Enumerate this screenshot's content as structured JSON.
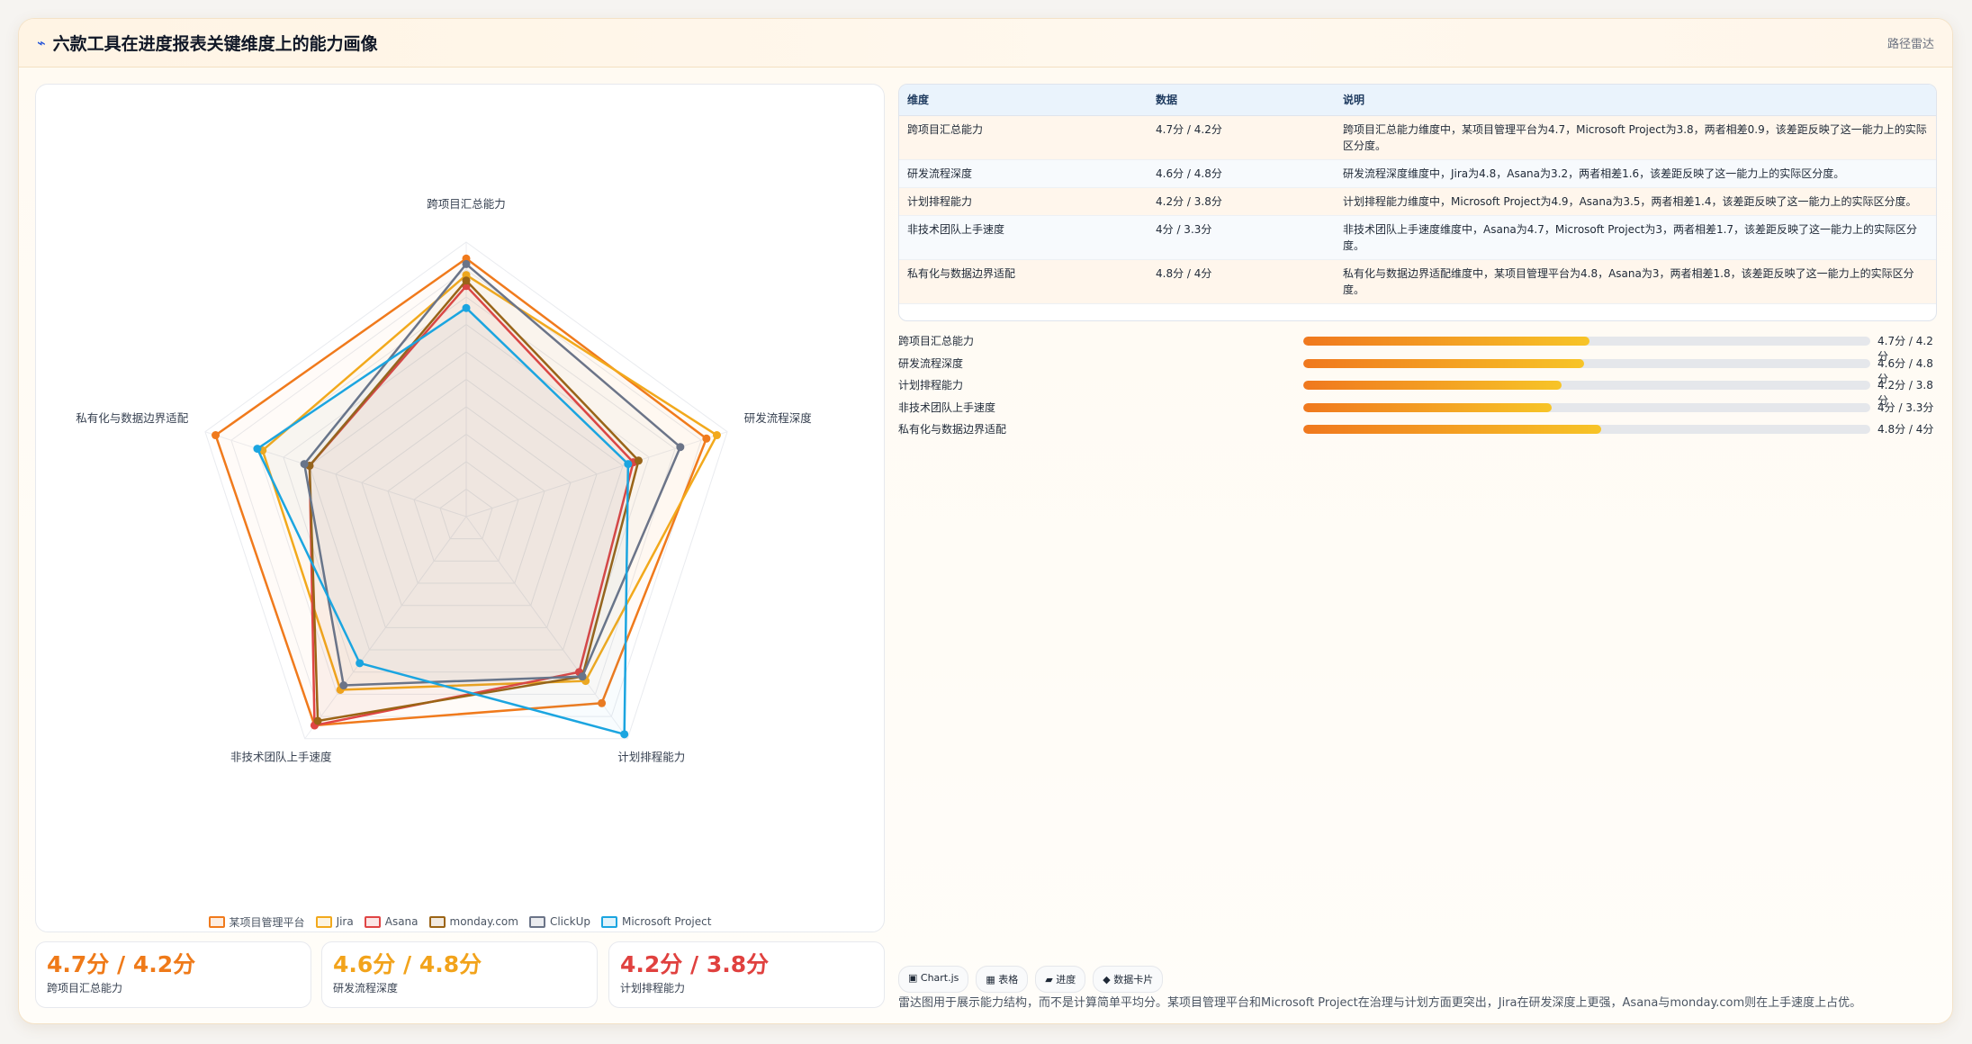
{
  "header": {
    "icon": "route-icon",
    "title": "六款工具在进度报表关键维度上的能力画像",
    "tag": "路径雷达"
  },
  "chart_data": {
    "type": "radar",
    "axes": [
      "跨项目汇总能力",
      "研发流程深度",
      "计划排程能力",
      "非技术团队上手速度",
      "私有化与数据边界适配"
    ],
    "range": [
      0,
      5
    ],
    "grid_levels": 10,
    "series": [
      {
        "name": "某项目管理平台",
        "color": "#f07a1c",
        "values": [
          4.7,
          4.6,
          4.2,
          4.7,
          4.8
        ]
      },
      {
        "name": "Jira",
        "color": "#f2a91c",
        "values": [
          4.4,
          4.8,
          3.7,
          3.9,
          3.9
        ]
      },
      {
        "name": "Asana",
        "color": "#e04545",
        "values": [
          4.2,
          3.2,
          3.5,
          4.7,
          3.0
        ]
      },
      {
        "name": "monday.com",
        "color": "#9b6415",
        "values": [
          4.3,
          3.3,
          3.6,
          4.6,
          3.0
        ]
      },
      {
        "name": "ClickUp",
        "color": "#6b7488",
        "values": [
          4.6,
          4.1,
          3.6,
          3.8,
          3.1
        ]
      },
      {
        "name": "Microsoft Project",
        "color": "#1ba5e0",
        "values": [
          3.8,
          3.1,
          4.9,
          3.3,
          4.0
        ]
      }
    ]
  },
  "kpis": [
    {
      "value": "4.7分 / 4.2分",
      "label": "跨项目汇总能力",
      "color": "#ef7a19"
    },
    {
      "value": "4.6分 / 4.8分",
      "label": "研发流程深度",
      "color": "#f2a31b"
    },
    {
      "value": "4.2分 / 3.8分",
      "label": "计划排程能力",
      "color": "#e0413f"
    }
  ],
  "table": {
    "headers": [
      "维度",
      "数据",
      "说明"
    ],
    "rows": [
      [
        "跨项目汇总能力",
        "4.7分 / 4.2分",
        "跨项目汇总能力维度中，某项目管理平台为4.7，Microsoft Project为3.8，两者相差0.9，该差距反映了这一能力上的实际区分度。"
      ],
      [
        "研发流程深度",
        "4.6分 / 4.8分",
        "研发流程深度维度中，Jira为4.8，Asana为3.2，两者相差1.6，该差距反映了这一能力上的实际区分度。"
      ],
      [
        "计划排程能力",
        "4.2分 / 3.8分",
        "计划排程能力维度中，Microsoft Project为4.9，Asana为3.5，两者相差1.4，该差距反映了这一能力上的实际区分度。"
      ],
      [
        "非技术团队上手速度",
        "4分 / 3.3分",
        "非技术团队上手速度维度中，Asana为4.7，Microsoft Project为3，两者相差1.7，该差距反映了这一能力上的实际区分度。"
      ],
      [
        "私有化与数据边界适配",
        "4.8分 / 4分",
        "私有化与数据边界适配维度中，某项目管理平台为4.8，Asana为3，两者相差1.8，该差距反映了这一能力上的实际区分度。"
      ]
    ]
  },
  "bars": [
    {
      "label": "跨项目汇总能力",
      "value": "4.7分 / 4.2分",
      "fill_fraction": 0.505
    },
    {
      "label": "研发流程深度",
      "value": "4.6分 / 4.8分",
      "fill_fraction": 0.496
    },
    {
      "label": "计划排程能力",
      "value": "4.2分 / 3.8分",
      "fill_fraction": 0.455
    },
    {
      "label": "非技术团队上手速度",
      "value": "4分 / 3.3分",
      "fill_fraction": 0.438
    },
    {
      "label": "私有化与数据边界适配",
      "value": "4.8分 / 4分",
      "fill_fraction": 0.525
    }
  ],
  "chips": [
    "▣ Chart.js",
    "▦ 表格",
    "▰ 进度",
    "◆ 数据卡片"
  ],
  "note": "雷达图用于展示能力结构，而不是计算简单平均分。某项目管理平台和Microsoft Project在治理与计划方面更突出，Jira在研发深度上更强，Asana与monday.com则在上手速度上占优。"
}
